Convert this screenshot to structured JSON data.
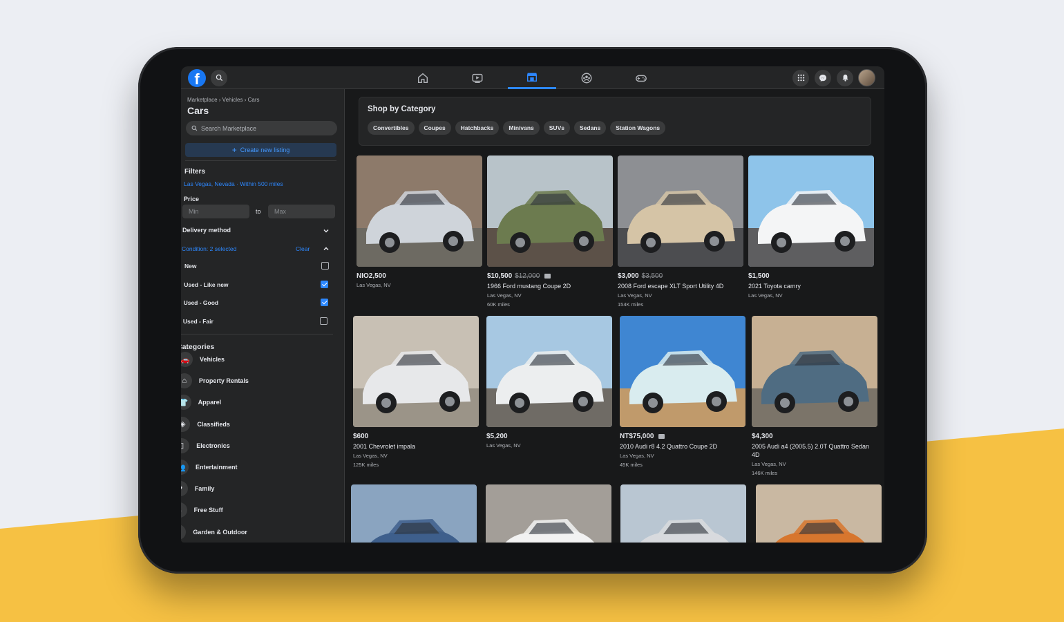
{
  "colors": {
    "accent": "#2d88ff",
    "background": "#18191a",
    "surface": "#242526",
    "brand": "#1877f2",
    "yellow": "#f6c143"
  },
  "topbar": {
    "logo": "f",
    "nav_icons": [
      "home-icon",
      "watch-icon",
      "marketplace-icon",
      "groups-icon",
      "gaming-icon"
    ],
    "right_icons": [
      "menu-grid-icon",
      "messenger-icon",
      "notifications-icon"
    ]
  },
  "sidebar": {
    "breadcrumb": "Marketplace › Vehicles › Cars",
    "title": "Cars",
    "search_placeholder": "Search Marketplace",
    "create_label": "Create new listing",
    "filters_label": "Filters",
    "location": "Las Vegas, Nevada · Within 500 miles",
    "price_label": "Price",
    "price_min_placeholder": "Min",
    "price_max_placeholder": "Max",
    "price_to": "to",
    "delivery_label": "Delivery method",
    "condition_label": "Condition: 2 selected",
    "clear_label": "Clear",
    "conditions": [
      {
        "label": "New",
        "checked": false
      },
      {
        "label": "Used - Like new",
        "checked": true
      },
      {
        "label": "Used - Good",
        "checked": true
      },
      {
        "label": "Used - Fair",
        "checked": false
      }
    ],
    "categories_label": "Categories",
    "categories": [
      {
        "label": "Vehicles",
        "icon": "car-icon"
      },
      {
        "label": "Property Rentals",
        "icon": "house-icon"
      },
      {
        "label": "Apparel",
        "icon": "shirt-icon"
      },
      {
        "label": "Classifieds",
        "icon": "tag-icon"
      },
      {
        "label": "Electronics",
        "icon": "phone-icon"
      },
      {
        "label": "Entertainment",
        "icon": "people-icon"
      },
      {
        "label": "Family",
        "icon": "heart-icon"
      },
      {
        "label": "Free Stuff",
        "icon": "price-tag-icon"
      },
      {
        "label": "Garden & Outdoor",
        "icon": "leaf-icon"
      }
    ]
  },
  "main": {
    "category_heading": "Shop by Category",
    "chips": [
      "Convertibles",
      "Coupes",
      "Hatchbacks",
      "Minivans",
      "SUVs",
      "Sedans",
      "Station Wagons"
    ],
    "listings": [
      {
        "price": "NIO2,500",
        "old_price": "",
        "video": false,
        "title": "",
        "location": "Las Vegas, NV",
        "miles": "",
        "photo": {
          "sky": "#8d7a6a",
          "body": "#cfd4da",
          "ground": "#6d6a62"
        }
      },
      {
        "price": "$10,500",
        "old_price": "$12,000",
        "video": true,
        "title": "1966 Ford mustang Coupe 2D",
        "location": "Las Vegas, NV",
        "miles": "60K miles",
        "photo": {
          "sky": "#b8c3c9",
          "body": "#6c7b4f",
          "ground": "#5c5148"
        }
      },
      {
        "price": "$3,000",
        "old_price": "$3,500",
        "video": false,
        "title": "2008 Ford escape XLT Sport Utility 4D",
        "location": "Las Vegas, NV",
        "miles": "154K miles",
        "photo": {
          "sky": "#8d8f93",
          "body": "#d5c4a6",
          "ground": "#4c4d50"
        }
      },
      {
        "price": "$1,500",
        "old_price": "",
        "video": false,
        "title": "2021 Toyota camry",
        "location": "Las Vegas, NV",
        "miles": "",
        "photo": {
          "sky": "#8ec4ea",
          "body": "#f4f5f6",
          "ground": "#5e5e60"
        }
      },
      {
        "price": "$600",
        "old_price": "",
        "video": false,
        "title": "2001 Chevrolet impala",
        "location": "Las Vegas, NV",
        "miles": "125K miles",
        "photo": {
          "sky": "#c8c0b4",
          "body": "#e7e8ea",
          "ground": "#9b9488"
        }
      },
      {
        "price": "$5,200",
        "old_price": "",
        "video": false,
        "title": "",
        "location": "Las Vegas, NV",
        "miles": "",
        "photo": {
          "sky": "#a7c8e2",
          "body": "#eceeef",
          "ground": "#6f6b65"
        }
      },
      {
        "price": "NT$75,000",
        "old_price": "",
        "video": true,
        "title": "2010 Audi r8 4.2 Quattro Coupe 2D",
        "location": "Las Vegas, NV",
        "miles": "45K miles",
        "photo": {
          "sky": "#3f86d2",
          "body": "#d9ecef",
          "ground": "#c09a6b"
        }
      },
      {
        "price": "$4,300",
        "old_price": "",
        "video": false,
        "title": "2005 Audi a4 (2005.5) 2.0T Quattro Sedan 4D",
        "location": "Las Vegas, NV",
        "miles": "146K miles",
        "photo": {
          "sky": "#c7b093",
          "body": "#4f6c82",
          "ground": "#7b7469"
        }
      },
      {
        "price": "",
        "old_price": "",
        "video": false,
        "title": "",
        "location": "",
        "miles": "",
        "photo": {
          "sky": "#8aa4c0",
          "body": "#3e5f8c",
          "ground": "#6a6b6f"
        }
      },
      {
        "price": "",
        "old_price": "",
        "video": false,
        "title": "",
        "location": "",
        "miles": "",
        "photo": {
          "sky": "#a39e98",
          "body": "#f2f2f2",
          "ground": "#5a5a5a"
        }
      },
      {
        "price": "",
        "old_price": "",
        "video": false,
        "title": "",
        "location": "",
        "miles": "",
        "photo": {
          "sky": "#b9c6d2",
          "body": "#d8dade",
          "ground": "#6a6a6a"
        }
      },
      {
        "price": "",
        "old_price": "",
        "video": false,
        "title": "",
        "location": "",
        "miles": "",
        "photo": {
          "sky": "#c9b8a2",
          "body": "#d7762e",
          "ground": "#7b6f62"
        }
      }
    ]
  }
}
